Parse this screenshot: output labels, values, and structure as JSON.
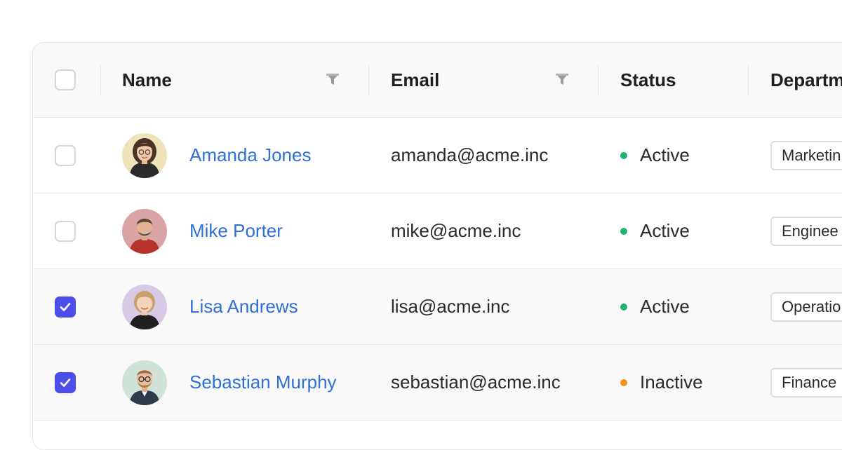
{
  "table": {
    "headers": {
      "name": "Name",
      "email": "Email",
      "status": "Status",
      "department": "Departm"
    },
    "rows": [
      {
        "name": "Amanda Jones",
        "email": "amanda@acme.inc",
        "status": "Active",
        "department": "Marketin",
        "selected": false
      },
      {
        "name": "Mike Porter",
        "email": "mike@acme.inc",
        "status": "Active",
        "department": "Enginee",
        "selected": false
      },
      {
        "name": "Lisa Andrews",
        "email": "lisa@acme.inc",
        "status": "Active",
        "department": "Operatio",
        "selected": true
      },
      {
        "name": "Sebastian Murphy",
        "email": "sebastian@acme.inc",
        "status": "Inactive",
        "department": "Finance",
        "selected": true
      }
    ]
  },
  "colors": {
    "active": "#21b36b",
    "inactive": "#f0901e",
    "link": "#2f6fd6",
    "checkbox_checked": "#4b4ee8"
  },
  "icons": {
    "filter": "filter-icon",
    "check": "check-icon"
  }
}
